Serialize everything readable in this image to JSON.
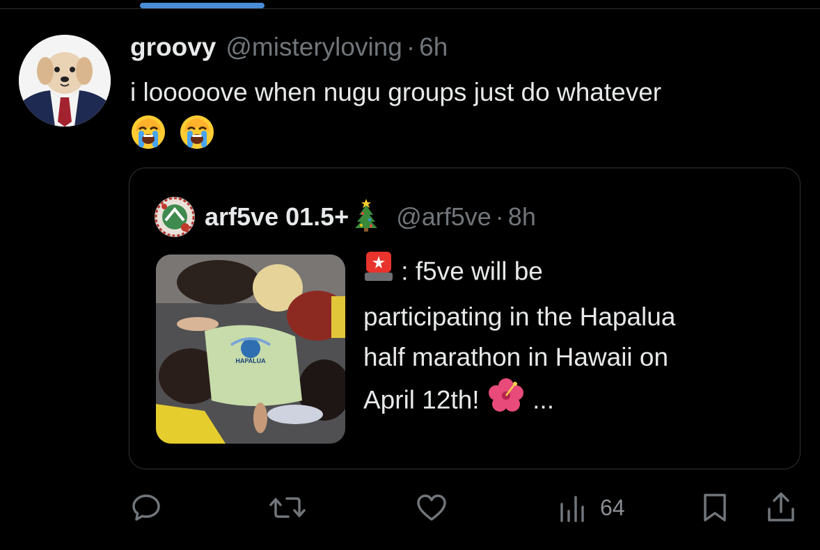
{
  "tweet": {
    "display_name": "groovy",
    "handle": "@misteryloving",
    "separator": "·",
    "time": "6h",
    "text": "i looooove when nugu groups just do whatever",
    "emojis": [
      "loudly-crying-face",
      "loudly-crying-face"
    ]
  },
  "quote": {
    "display_name": "arf5ve 01.5+",
    "name_emoji": "christmas-tree",
    "handle": "@arf5ve",
    "separator": "·",
    "time": "8h",
    "text_prefix_emoji": "police-car-light",
    "text_line1": ": f5ve will be",
    "text_line2": "participating in the Hapalua",
    "text_line3": "half marathon in Hawaii on",
    "text_line4": "April 12th!",
    "text_suffix_emoji": "hibiscus",
    "text_ellipsis": "...",
    "media_shirt_text": "HAPALUA"
  },
  "actions": {
    "reply_icon": "speech-bubble-icon",
    "repost_icon": "repost-arrows-icon",
    "like_icon": "heart-icon",
    "views_icon": "bar-chart-icon",
    "views_count": "64",
    "bookmark_icon": "bookmark-icon",
    "share_icon": "share-upload-icon"
  },
  "colors": {
    "background": "#000000",
    "primary_text": "#e7e9ea",
    "secondary_text": "#71767b",
    "border": "#2f3336",
    "tab_indicator": "#4a8bd6"
  }
}
